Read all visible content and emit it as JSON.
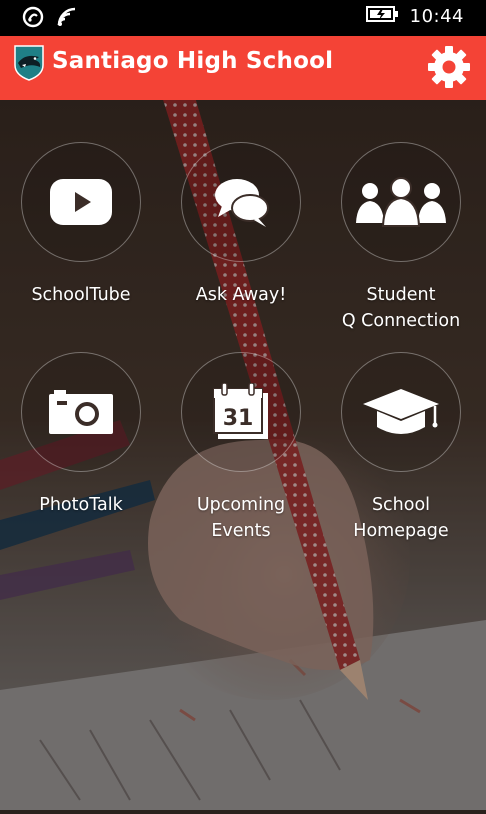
{
  "status_bar": {
    "time": "10:44",
    "icons": [
      "nfc-icon",
      "wifi-icon",
      "battery-charging-icon"
    ]
  },
  "header": {
    "title": "Santiago High School",
    "logo_icon": "santiago-shark-logo",
    "settings_icon": "gear-icon",
    "background_color": "#f44336"
  },
  "tiles": [
    {
      "label": "SchoolTube",
      "icon": "youtube-icon"
    },
    {
      "label": "Ask Away!",
      "icon": "chat-bubbles-icon"
    },
    {
      "label": "Student\nQ Connection",
      "icon": "people-group-icon"
    },
    {
      "label": "PhotoTalk",
      "icon": "camera-icon"
    },
    {
      "label": "Upcoming\nEvents",
      "icon": "calendar-icon",
      "calendar_day": "31"
    },
    {
      "label": "School\nHomepage",
      "icon": "graduation-cap-icon"
    }
  ]
}
